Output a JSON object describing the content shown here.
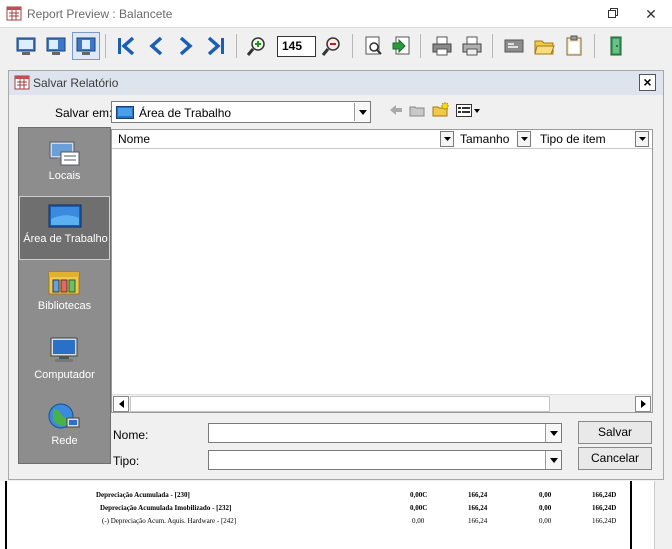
{
  "window": {
    "title": "Report Preview : Balancete",
    "controls": [
      "restore-icon",
      "close-icon"
    ]
  },
  "toolbar": {
    "zoom_value": "145",
    "buttons": [
      "page-width-icon",
      "full-page-icon",
      "one-page-icon",
      "first-page-icon",
      "previous-page-icon",
      "next-page-icon",
      "last-page-icon",
      "zoom-in-icon",
      "zoom-out-icon",
      "find-icon",
      "go-to-icon",
      "print-icon",
      "print-setup-icon",
      "export-icon",
      "open-icon",
      "clipboard-icon",
      "exit-icon"
    ]
  },
  "dialog": {
    "title": "Salvar Relatório",
    "close_label": "×",
    "look_in_label": "Salvar em:",
    "look_in_value": "Área de Trabalho",
    "places": [
      {
        "label": "Locais",
        "icon": "recent-places-icon"
      },
      {
        "label": "Área de Trabalho",
        "icon": "desktop-icon",
        "selected": true
      },
      {
        "label": "Bibliotecas",
        "icon": "libraries-icon"
      },
      {
        "label": "Computador",
        "icon": "computer-icon"
      },
      {
        "label": "Rede",
        "icon": "network-icon"
      }
    ],
    "columns": [
      "Nome",
      "Tamanho",
      "Tipo de item"
    ],
    "file_name_label": "Nome:",
    "file_name_value": "",
    "file_type_label": "Tipo:",
    "file_type_value": "",
    "save_button": "Salvar",
    "cancel_button": "Cancelar"
  },
  "report": {
    "rows": [
      {
        "desc": "Depreciação Acumulada - [230]",
        "c1": "0,00C",
        "c2": "166,24",
        "c3": "0,00",
        "c4": "166,24D"
      },
      {
        "desc": "Depreciação Acumulada Imobilizado - [232]",
        "c1": "0,00C",
        "c2": "166,24",
        "c3": "0,00",
        "c4": "166,24D"
      },
      {
        "desc": "(-) Depreciação Acum. Aquis. Hardware - [242]",
        "c1": "0,00",
        "c2": "166,24",
        "c3": "0,00",
        "c4": "166,24D"
      }
    ]
  },
  "colors": {
    "accent": "#1a5fb4",
    "places_bg": "#8d8d8d",
    "dialog_title_bg": "#dde4ee"
  }
}
